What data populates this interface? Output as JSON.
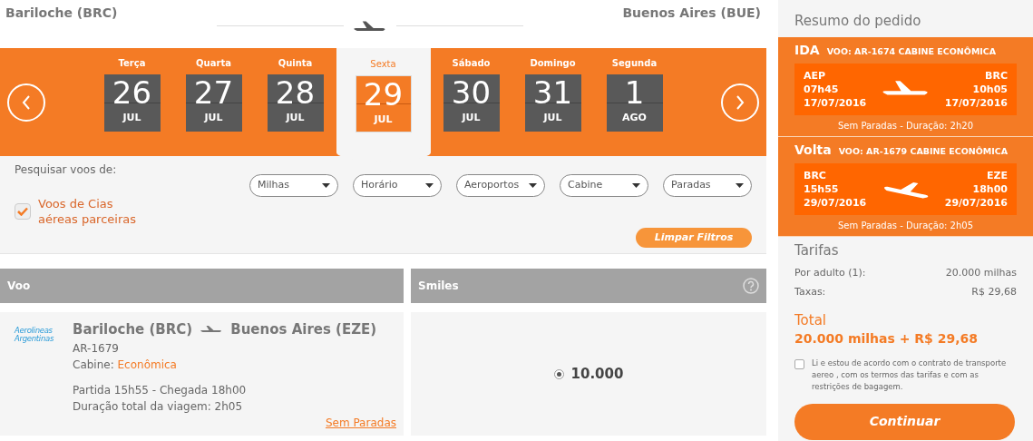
{
  "route": {
    "origin": "Bariloche (BRC)",
    "destination": "Buenos Aires (BUE)"
  },
  "dates": [
    {
      "weekday": "Terça",
      "day": "26",
      "month": "JUL",
      "selected": false
    },
    {
      "weekday": "Quarta",
      "day": "27",
      "month": "JUL",
      "selected": false
    },
    {
      "weekday": "Quinta",
      "day": "28",
      "month": "JUL",
      "selected": false
    },
    {
      "weekday": "Sexta",
      "day": "29",
      "month": "JUL",
      "selected": true
    },
    {
      "weekday": "Sábado",
      "day": "30",
      "month": "JUL",
      "selected": false
    },
    {
      "weekday": "Domingo",
      "day": "31",
      "month": "JUL",
      "selected": false
    },
    {
      "weekday": "Segunda",
      "day": "1",
      "month": "AGO",
      "selected": false
    }
  ],
  "filters": {
    "label": "Pesquisar voos de:",
    "partner": {
      "label": "Voos de Cias aéreas parceiras",
      "checked": true
    },
    "dropdowns": [
      "Milhas",
      "Horário",
      "Aeroportos",
      "Cabine",
      "Paradas"
    ],
    "clear_button": "Limpar Filtros"
  },
  "table": {
    "columns": [
      "Voo",
      "Smiles"
    ],
    "rows": [
      {
        "airline_logo": [
          "Aerolineas",
          "Argentinas"
        ],
        "origin": "Bariloche (BRC)",
        "destination": "Buenos Aires (EZE)",
        "flight": "AR-1679",
        "cabin_label": "Cabine:",
        "cabin": "Econômica",
        "times": "Partida 15h55 - Chegada 18h00",
        "duration": "Duração total da viagem: 2h05",
        "stops": "Sem Paradas",
        "miles": "10.000",
        "selected": true
      }
    ]
  },
  "summary": {
    "title": "Resumo do pedido",
    "segments": [
      {
        "label": "IDA",
        "flight": "VOO: AR-1674 CABINE ECONÔMICA",
        "from": "AEP",
        "from_time": "07h45",
        "from_date": "17/07/2016",
        "to": "BRC",
        "to_time": "10h05",
        "to_date": "17/07/2016",
        "info": "Sem Paradas - Duração: 2h20",
        "kind": "outbound"
      },
      {
        "label": "Volta",
        "flight": "VOO: AR-1679 CABINE ECONÔMICA",
        "from": "BRC",
        "from_time": "15h55",
        "from_date": "29/07/2016",
        "to": "EZE",
        "to_time": "18h00",
        "to_date": "29/07/2016",
        "info": "Sem Paradas - Duração: 2h05",
        "kind": "return"
      }
    ],
    "fares_title": "Tarifas",
    "fares": [
      {
        "label": "Por adulto (1):",
        "value": "20.000 milhas"
      },
      {
        "label": "Taxas:",
        "value": "R$ 29,68"
      }
    ],
    "total_label": "Total",
    "total": "20.000 milhas + **R$ 29,68**",
    "terms": {
      "text": "Li e estou de acordo com o contrato de transporte aereo , com os termos das tarifas e com as restrições de bagagem.",
      "checked": false
    },
    "continue_button": "Continuar"
  }
}
